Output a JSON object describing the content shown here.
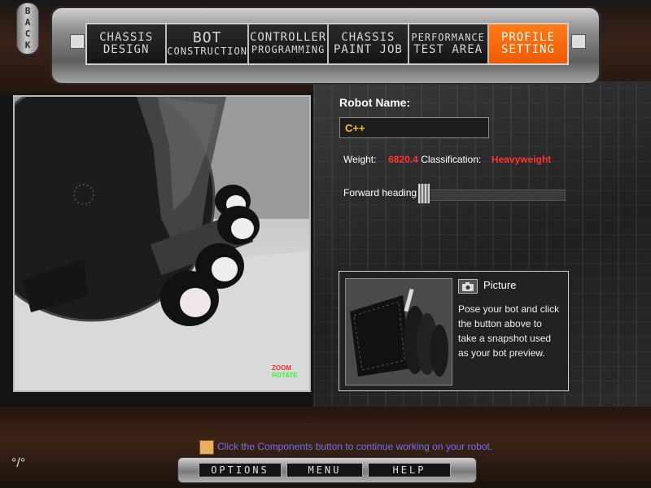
{
  "window": {
    "back_label": "BACK"
  },
  "nav": {
    "tabs": [
      {
        "line1": "CHASSIS",
        "line2": "DESIGN",
        "active": false
      },
      {
        "line1": "BOT",
        "line2": "CONSTRUCTION",
        "active": false
      },
      {
        "line1": "CONTROLLER",
        "line2": "PROGRAMMING",
        "active": false
      },
      {
        "line1": "CHASSIS",
        "line2": "PAINT JOB",
        "active": false
      },
      {
        "line1": "PERFORMANCE",
        "line2": "TEST AREA",
        "active": false
      },
      {
        "line1": "PROFILE",
        "line2": "SETTING",
        "active": true
      }
    ]
  },
  "viewport": {
    "zoom_label": "ZOOM",
    "rotate_label": "ROTATE"
  },
  "profile": {
    "name_label": "Robot Name:",
    "name_value": "C++",
    "weight_label": "Weight:",
    "weight_value": "6820.4",
    "classification_label": "Classification:",
    "classification_value": "Heavyweight",
    "heading_label": "Forward heading:",
    "heading_level": 0.0
  },
  "picture": {
    "title": "Picture",
    "help": "Pose your bot and click the button above to take a snapshot used as your bot preview."
  },
  "status": {
    "message": "Click the Components button to continue working on your robot."
  },
  "bottom": {
    "options_label": "OPTIONS",
    "menu_label": "MENU",
    "help_label": "HELP"
  },
  "colors": {
    "accent": "#f05a00",
    "warning": "#ff3333",
    "name_text": "#ffc020",
    "status_text": "#7b6cf0"
  },
  "icons": {
    "camera": "camera-icon",
    "status": "info-icon",
    "corner": "tool-icon"
  }
}
